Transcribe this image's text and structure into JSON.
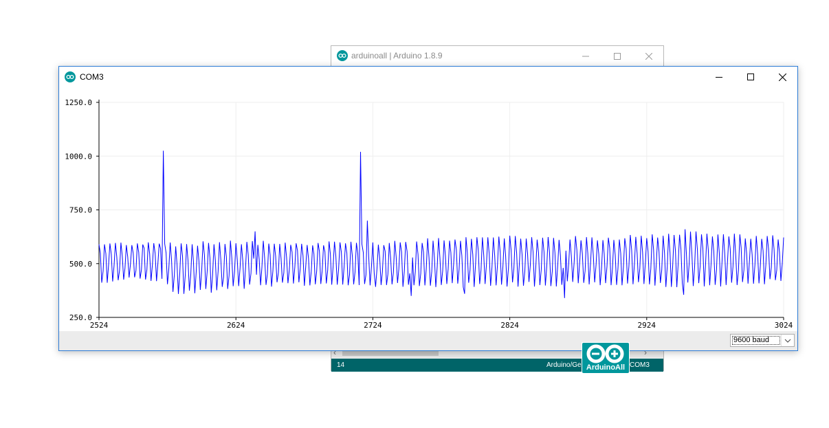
{
  "ide_window": {
    "title": "arduinoall | Arduino 1.8.9",
    "status": {
      "line": "14",
      "board": "Arduino/Ge",
      "port": "COM3"
    }
  },
  "plotter_window": {
    "title": "COM3",
    "baud": "9600 baud"
  },
  "logo": {
    "text": "ArduinoAll"
  },
  "colors": {
    "series": "#0000ff",
    "teal": "#006468",
    "accent": "#00979c"
  },
  "chart_data": {
    "type": "line",
    "x_range": [
      2524,
      3024
    ],
    "ylim": [
      250,
      1250
    ],
    "y_ticks": [
      "250.0",
      "500.0",
      "750.0",
      "1000.0",
      "1250.0"
    ],
    "x_ticks": [
      "2524",
      "2624",
      "2724",
      "2824",
      "2924",
      "3024"
    ],
    "grid": true,
    "series": [
      {
        "color": "#0000ff",
        "baseline": [
          {
            "x": 2524,
            "lo": 420,
            "hi": 590
          },
          {
            "x": 2571,
            "lo": 430,
            "hi": 600
          },
          {
            "x": 2580,
            "lo": 360,
            "hi": 590
          },
          {
            "x": 2660,
            "lo": 410,
            "hi": 600
          },
          {
            "x": 2710,
            "lo": 400,
            "hi": 590
          },
          {
            "x": 2740,
            "lo": 400,
            "hi": 600
          },
          {
            "x": 2800,
            "lo": 400,
            "hi": 620
          },
          {
            "x": 2900,
            "lo": 410,
            "hi": 620
          },
          {
            "x": 2960,
            "lo": 400,
            "hi": 640
          },
          {
            "x": 3024,
            "lo": 420,
            "hi": 620
          }
        ],
        "spikes": [
          {
            "x": 2571,
            "y": 1025
          },
          {
            "x": 2715,
            "y": 1020
          },
          {
            "x": 2638,
            "y": 650
          },
          {
            "x": 2720,
            "y": 700
          },
          {
            "x": 2725,
            "y": 455
          },
          {
            "x": 2752,
            "y": 350
          },
          {
            "x": 2791,
            "y": 360
          },
          {
            "x": 2864,
            "y": 340
          },
          {
            "x": 2951,
            "y": 355
          },
          {
            "x": 2952,
            "y": 660
          }
        ]
      }
    ]
  }
}
